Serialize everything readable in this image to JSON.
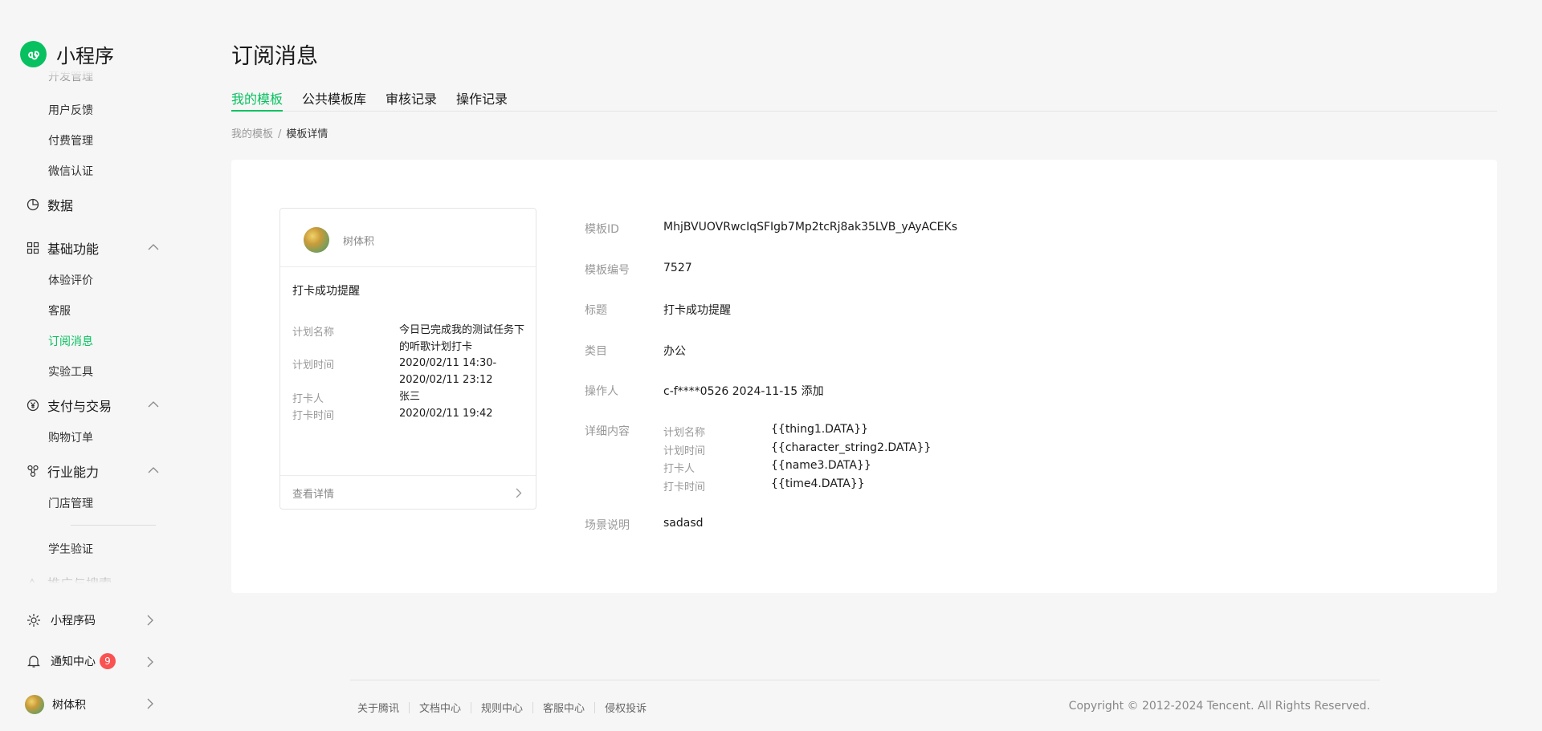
{
  "app": {
    "title": "小程序"
  },
  "sidebar": {
    "partial_top": "开发管理",
    "items_1": [
      "用户反馈",
      "付费管理",
      "微信认证"
    ],
    "data": "数据",
    "basic": {
      "label": "基础功能",
      "items": [
        "体验评价",
        "客服",
        "订阅消息",
        "实验工具"
      ]
    },
    "pay": {
      "label": "支付与交易",
      "items": [
        "购物订单"
      ]
    },
    "industry": {
      "label": "行业能力",
      "items": [
        "门店管理",
        "学生验证"
      ]
    },
    "partial_bottom": "推广与搜索",
    "qrcode": "小程序码",
    "notice": "通知中心",
    "notice_count": "9",
    "user": "树体积"
  },
  "page": {
    "title": "订阅消息",
    "tabs": [
      "我的模板",
      "公共模板库",
      "审核记录",
      "操作记录"
    ],
    "breadcrumb": {
      "parent": "我的模板",
      "sep": "/",
      "current": "模板详情"
    }
  },
  "preview": {
    "account": "树体积",
    "title": "打卡成功提醒",
    "rows": [
      {
        "k": "计划名称",
        "v": "今日已完成我的测试任务下的听歌计划打卡"
      },
      {
        "k": "计划时间",
        "v": "2020/02/11 14:30-2020/02/11 23:12"
      },
      {
        "k": "打卡人",
        "v": "张三"
      },
      {
        "k": "打卡时间",
        "v": "2020/02/11 19:42"
      }
    ],
    "footer": "查看详情"
  },
  "detail": {
    "id_label": "模板ID",
    "id": "MhjBVUOVRwcIqSFIgb7Mp2tcRj8ak35LVB_yAyACEKs",
    "no_label": "模板编号",
    "no": "7527",
    "title_label": "标题",
    "title": "打卡成功提醒",
    "cat_label": "类目",
    "cat": "办公",
    "op_label": "操作人",
    "op": "c-f****0526 2024-11-15 添加",
    "content_label": "详细内容",
    "content": [
      {
        "k": "计划名称",
        "v": "{{thing1.DATA}}"
      },
      {
        "k": "计划时间",
        "v": "{{character_string2.DATA}}"
      },
      {
        "k": "打卡人",
        "v": "{{name3.DATA}}"
      },
      {
        "k": "打卡时间",
        "v": "{{time4.DATA}}"
      }
    ],
    "scene_label": "场景说明",
    "scene": "sadasd"
  },
  "footer": {
    "links": [
      "关于腾讯",
      "文档中心",
      "规则中心",
      "客服中心",
      "侵权投诉"
    ],
    "copyright": "Copyright © 2012-2024 Tencent. All Rights Reserved."
  },
  "colors": {
    "accent": "#07c160",
    "badge": "#fa5151"
  }
}
